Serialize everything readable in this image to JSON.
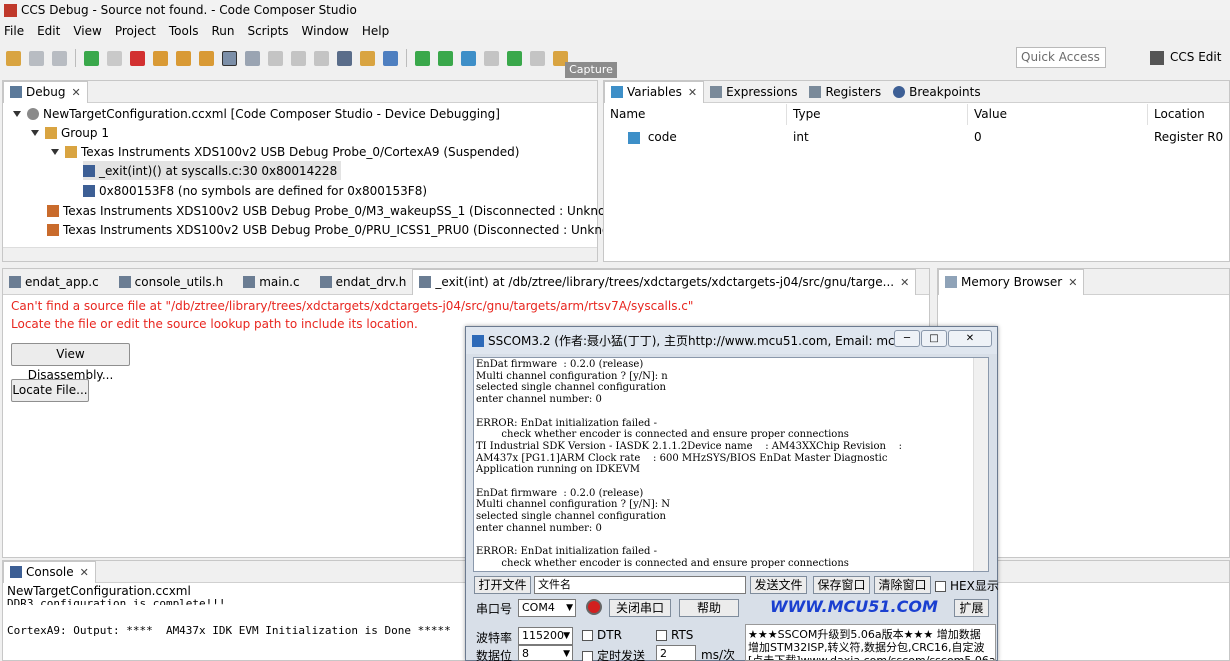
{
  "window": {
    "title": "CCS Debug - Source not found. - Code Composer Studio"
  },
  "menu": [
    "File",
    "Edit",
    "View",
    "Project",
    "Tools",
    "Run",
    "Scripts",
    "Window",
    "Help"
  ],
  "toolbar": {
    "tooltip": "Capture",
    "quick_access_placeholder": "Quick Access",
    "perspective_label": "CCS Edit"
  },
  "debug_view": {
    "tab_label": "Debug",
    "items": [
      "NewTargetConfiguration.ccxml [Code Composer Studio - Device Debugging]",
      "Group 1",
      "Texas Instruments XDS100v2 USB Debug Probe_0/CortexA9 (Suspended)",
      "_exit(int)() at syscalls.c:30 0x80014228",
      "0x800153F8  (no symbols are defined for 0x800153F8)",
      "Texas Instruments XDS100v2 USB Debug Probe_0/M3_wakeupSS_1 (Disconnected : Unknov",
      "Texas Instruments XDS100v2 USB Debug Probe_0/PRU_ICSS1_PRU0 (Disconnected : Unkno"
    ]
  },
  "variables_view": {
    "tabs": [
      "Variables",
      "Expressions",
      "Registers",
      "Breakpoints"
    ],
    "columns": [
      "Name",
      "Type",
      "Value",
      "Location"
    ],
    "rows": [
      {
        "name": "code",
        "type": "int",
        "value": "0",
        "location": "Register R0"
      }
    ]
  },
  "editor": {
    "tabs": [
      "endat_app.c",
      "console_utils.h",
      "main.c",
      "endat_drv.h",
      "_exit(int) at /db/ztree/library/trees/xdctargets/xdctargets-j04/src/gnu/targe..."
    ],
    "error_line1": "Can't find a source file at \"/db/ztree/library/trees/xdctargets/xdctargets-j04/src/gnu/targets/arm/rtsv7A/syscalls.c\"",
    "error_line2": "Locate the file or edit the source lookup path to include its location.",
    "view_disassembly_label": "View Disassembly...",
    "locate_file_label": "Locate File..."
  },
  "memory_view": {
    "tab_label": "Memory Browser"
  },
  "console": {
    "tab_label": "Console",
    "config_label": "NewTargetConfiguration.ccxml",
    "partial_line": "DDR3 configuration is complete!!!",
    "output_line": "CortexA9: Output: ****  AM437x IDK EVM Initialization is Done *****"
  },
  "sscom": {
    "title": "SSCOM3.2 (作者:聂小猛(丁丁), 主页http://www.mcu51.com,  Email: mc...",
    "receive_text": "EnDat firmware  : 0.2.0 (release)\nMulti channel configuration ? [y/N]: n\nselected single channel configuration\nenter channel number: 0\n\nERROR: EnDat initialization failed -\n        check whether encoder is connected and ensure proper connections\nTI Industrial SDK Version - IASDK 2.1.1.2Device name    : AM43XXChip Revision    :\nAM437x [PG1.1]ARM Clock rate    : 600 MHzSYS/BIOS EnDat Master Diagnostic\nApplication running on IDKEVM\n\nEnDat firmware  : 0.2.0 (release)\nMulti channel configuration ? [y/N]: N\nselected single channel configuration\nenter channel number: 0\n\nERROR: EnDat initialization failed -\n        check whether encoder is connected and ensure proper connections",
    "open_file_label": "打开文件",
    "filename_value": "文件名",
    "send_file_label": "发送文件",
    "save_window_label": "保存窗口",
    "clear_window_label": "清除窗口",
    "hex_display_label": "HEX显示",
    "port_label": "串口号",
    "port_value": "COM4",
    "close_port_label": "关闭串口",
    "help_label": "帮助",
    "website": "WWW.MCU51.COM",
    "expand_label": "扩展",
    "baud_label": "波特率",
    "baud_value": "115200",
    "dtr_label": "DTR",
    "rts_label": "RTS",
    "databits_label": "数据位",
    "databits_value": "8",
    "timed_send_label": "定时发送",
    "interval_value": "2",
    "interval_unit": "ms/次",
    "ad_line1": "★★★SSCOM升级到5.06a版本★★★ 增加数据",
    "ad_line2": "增加STM32ISP,转义符,数据分包,CRC16,自定波",
    "ad_line3": "[点击下载]www.daxia.com/sscom/sscom5.06a.z"
  }
}
